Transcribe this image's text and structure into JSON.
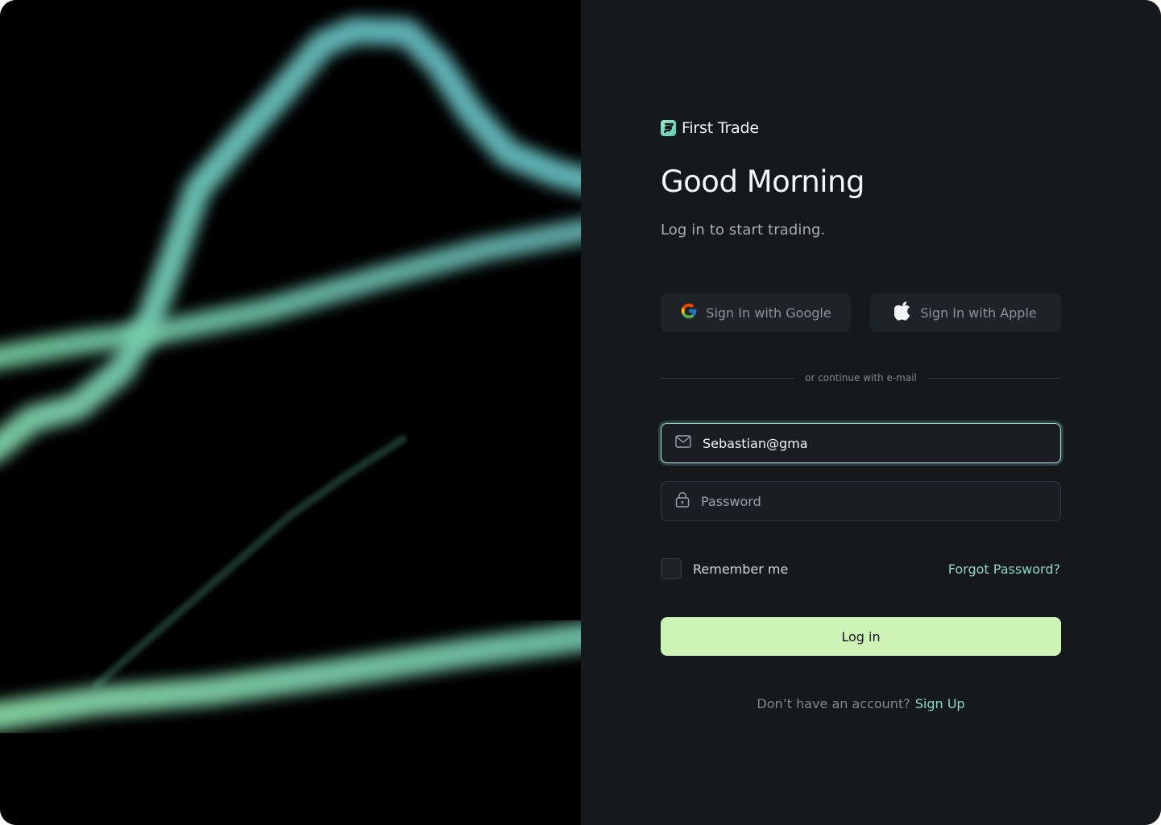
{
  "brand": {
    "name": "First Trade",
    "logo_icon": "first-trade-logo-icon",
    "accent": "#7fd9c2"
  },
  "heading": {
    "greeting": "Good Morning",
    "subtitle": "Log in  to start trading."
  },
  "social": {
    "google_label": "Sign In with Google",
    "google_icon": "google-icon",
    "apple_label": "Sign In with Apple",
    "apple_icon": "apple-icon"
  },
  "divider": {
    "text": "or continue with e-mail"
  },
  "form": {
    "email": {
      "value": "Sebastian@gma",
      "icon": "mail-icon"
    },
    "password": {
      "placeholder": "Password",
      "icon": "lock-icon"
    },
    "remember_label": "Remember me",
    "remember_checked": false,
    "forgot_label": "Forgot Password?",
    "submit_label": "Log in"
  },
  "footer": {
    "question": "Don’t have an account?",
    "signup_label": "Sign Up"
  },
  "colors": {
    "panel_bg": "#15191c",
    "art_bg": "#000000",
    "primary_button": "#cdf4b6",
    "link": "#8fd6c3"
  }
}
